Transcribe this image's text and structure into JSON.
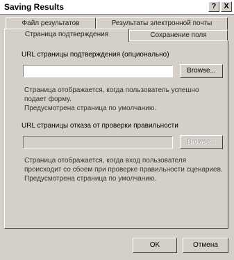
{
  "window": {
    "title": "Saving Results",
    "help_glyph": "?",
    "close_glyph": "X"
  },
  "tabs": {
    "back_row": [
      "Файл результатов",
      "Результаты электронной почты"
    ],
    "front_row": [
      "Страница подтверждения",
      "Сохранение поля"
    ]
  },
  "confirmation": {
    "url_label": "URL страницы подтверждения (опционально)",
    "url_value": "",
    "browse_label": "Browse...",
    "description_lines": [
      "Страница отображается, когда пользователь успешно",
      "подает форму.",
      "Предусмотрена страница по умолчанию."
    ]
  },
  "validation": {
    "url_label": "URL страницы отказа от проверки правильности",
    "url_value": "",
    "browse_label": "Browse...",
    "description_lines": [
      "Страница отображается, когда вход пользователя",
      "происходит со сбоем при проверке правильности сценариев.",
      "Предусмотрена страница по умолчанию."
    ]
  },
  "footer": {
    "ok_label": "OK",
    "cancel_label": "Отмена"
  }
}
